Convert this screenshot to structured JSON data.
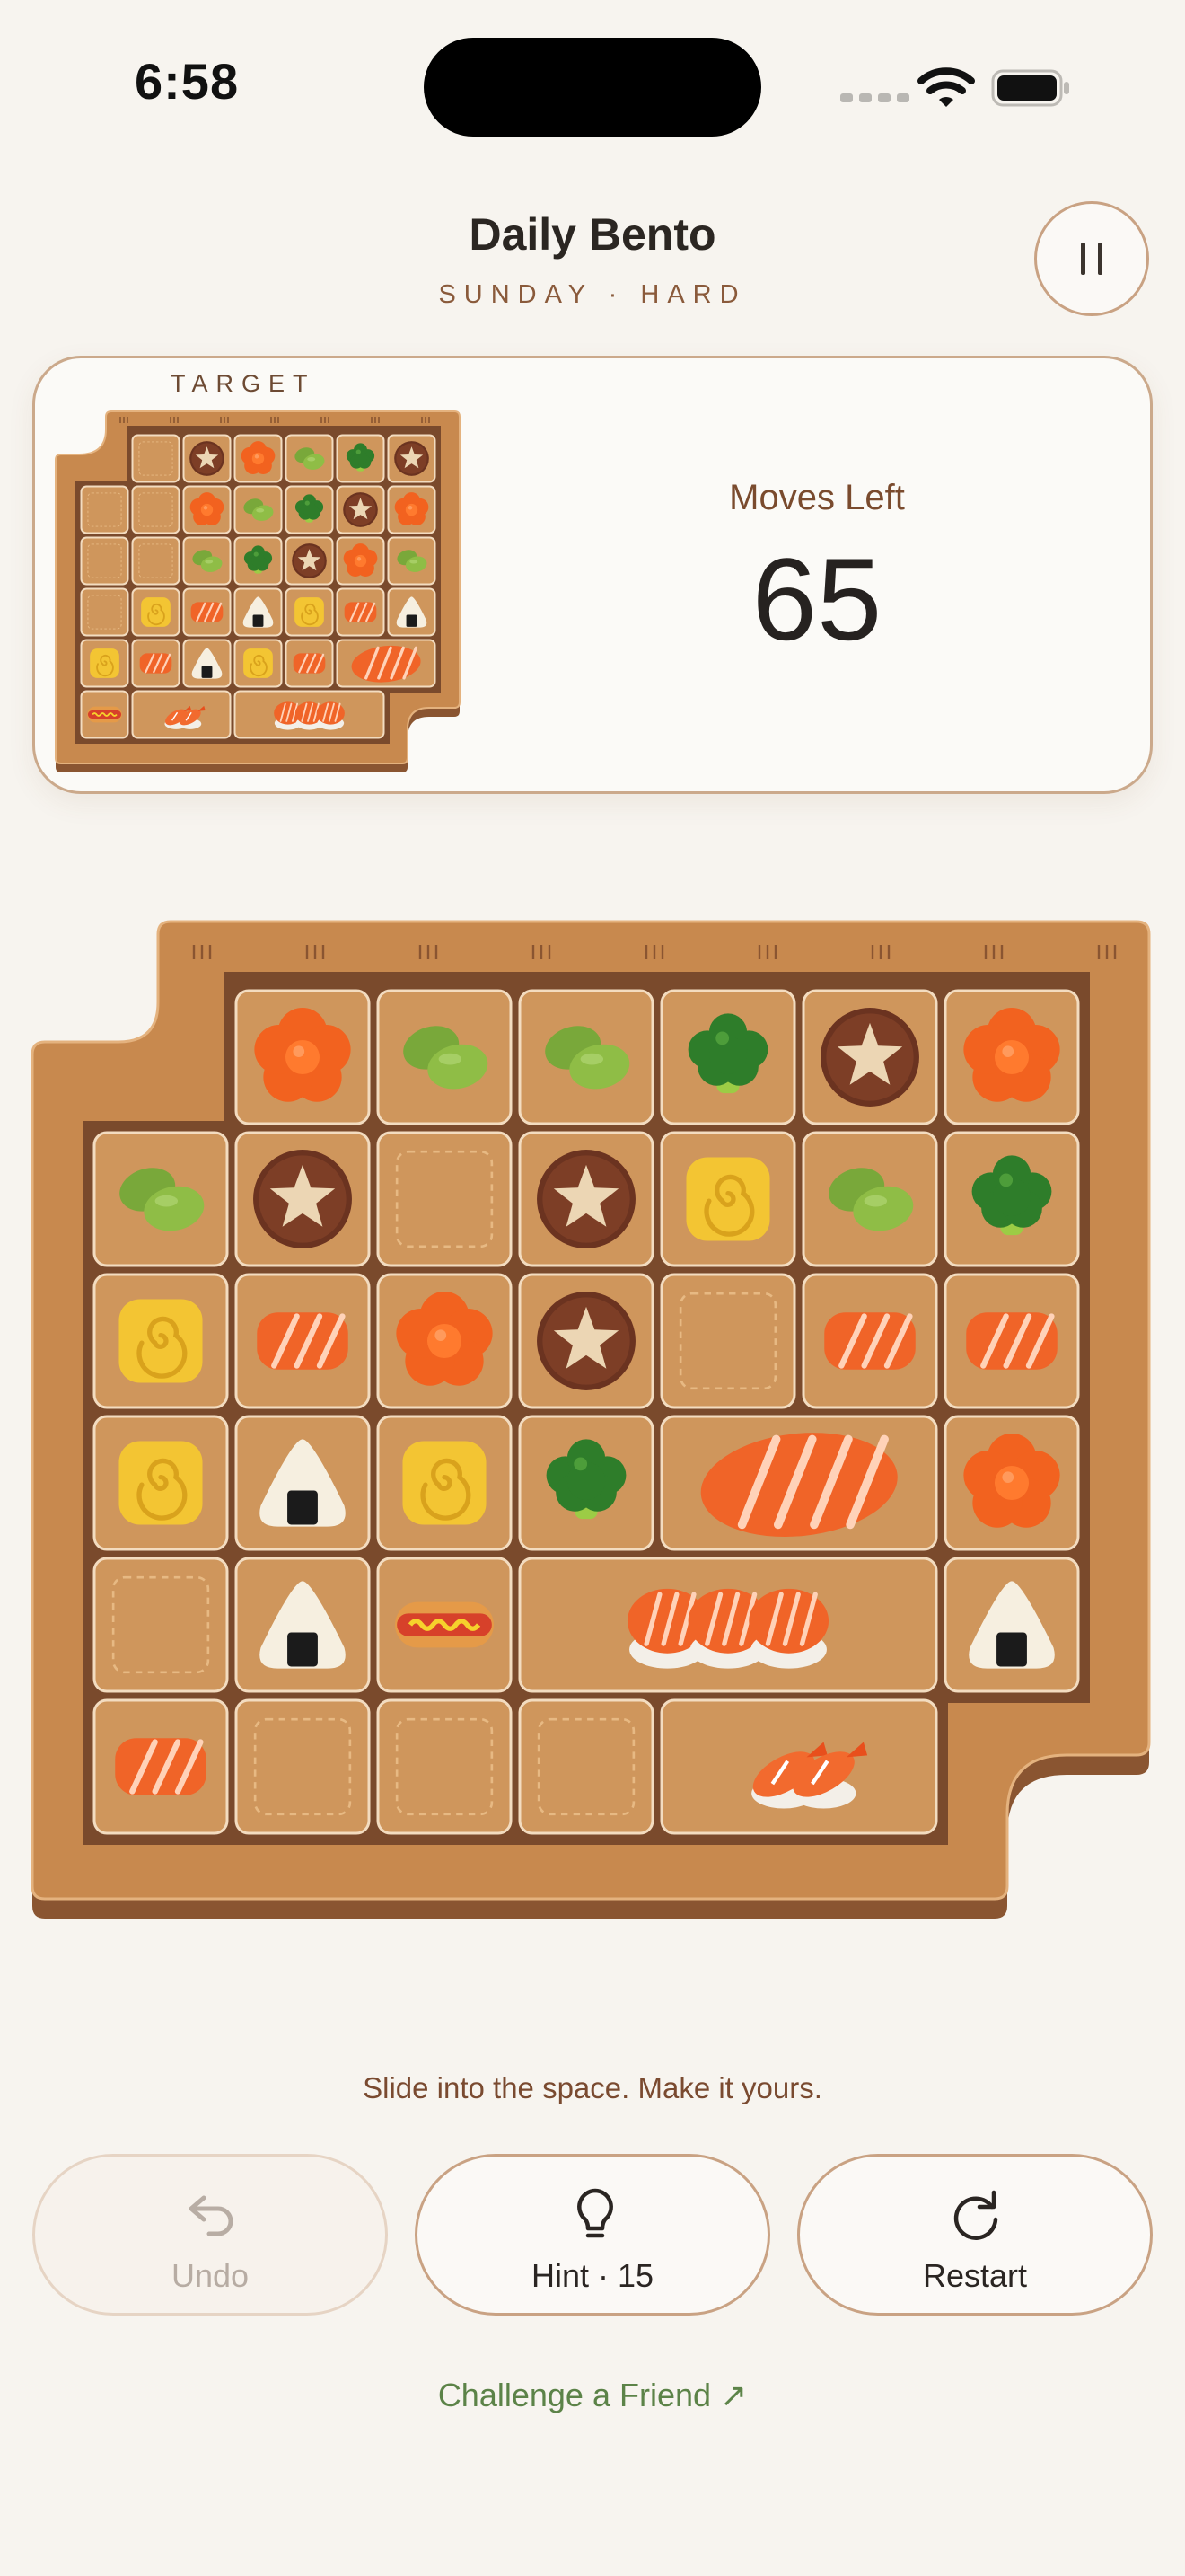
{
  "status_bar": {
    "time": "6:58"
  },
  "header": {
    "title": "Daily Bento",
    "subtitle": "SUNDAY · HARD"
  },
  "target_panel": {
    "label": "TARGET",
    "moves_label": "Moves Left",
    "moves_left": "65"
  },
  "board_layout": {
    "cols": 7,
    "rows": 6,
    "tiles": [
      {
        "r": 0,
        "c": 1,
        "w": 1,
        "h": 1,
        "item": "sakura"
      },
      {
        "r": 0,
        "c": 2,
        "w": 1,
        "h": 1,
        "item": "edamame"
      },
      {
        "r": 0,
        "c": 3,
        "w": 1,
        "h": 1,
        "item": "edamame"
      },
      {
        "r": 0,
        "c": 4,
        "w": 1,
        "h": 1,
        "item": "broccoli"
      },
      {
        "r": 0,
        "c": 5,
        "w": 1,
        "h": 1,
        "item": "shiitake"
      },
      {
        "r": 0,
        "c": 6,
        "w": 1,
        "h": 1,
        "item": "sakura"
      },
      {
        "r": 1,
        "c": 0,
        "w": 1,
        "h": 1,
        "item": "edamame"
      },
      {
        "r": 1,
        "c": 1,
        "w": 1,
        "h": 1,
        "item": "shiitake"
      },
      {
        "r": 1,
        "c": 2,
        "w": 1,
        "h": 1,
        "item": "empty"
      },
      {
        "r": 1,
        "c": 3,
        "w": 1,
        "h": 1,
        "item": "shiitake"
      },
      {
        "r": 1,
        "c": 4,
        "w": 1,
        "h": 1,
        "item": "tamago"
      },
      {
        "r": 1,
        "c": 5,
        "w": 1,
        "h": 1,
        "item": "edamame"
      },
      {
        "r": 1,
        "c": 6,
        "w": 1,
        "h": 1,
        "item": "broccoli"
      },
      {
        "r": 2,
        "c": 0,
        "w": 1,
        "h": 1,
        "item": "tamago"
      },
      {
        "r": 2,
        "c": 1,
        "w": 1,
        "h": 1,
        "item": "salmon"
      },
      {
        "r": 2,
        "c": 2,
        "w": 1,
        "h": 1,
        "item": "sakura"
      },
      {
        "r": 2,
        "c": 3,
        "w": 1,
        "h": 1,
        "item": "shiitake"
      },
      {
        "r": 2,
        "c": 4,
        "w": 1,
        "h": 1,
        "item": "empty"
      },
      {
        "r": 2,
        "c": 5,
        "w": 1,
        "h": 1,
        "item": "salmon"
      },
      {
        "r": 2,
        "c": 6,
        "w": 1,
        "h": 1,
        "item": "salmon"
      },
      {
        "r": 3,
        "c": 0,
        "w": 1,
        "h": 1,
        "item": "tamago"
      },
      {
        "r": 3,
        "c": 1,
        "w": 1,
        "h": 1,
        "item": "onigiri"
      },
      {
        "r": 3,
        "c": 2,
        "w": 1,
        "h": 1,
        "item": "tamago"
      },
      {
        "r": 3,
        "c": 3,
        "w": 1,
        "h": 1,
        "item": "broccoli"
      },
      {
        "r": 3,
        "c": 4,
        "w": 2,
        "h": 1,
        "item": "salmon-large"
      },
      {
        "r": 3,
        "c": 6,
        "w": 1,
        "h": 1,
        "item": "sakura"
      },
      {
        "r": 4,
        "c": 0,
        "w": 1,
        "h": 1,
        "item": "empty"
      },
      {
        "r": 4,
        "c": 1,
        "w": 1,
        "h": 1,
        "item": "onigiri"
      },
      {
        "r": 4,
        "c": 2,
        "w": 1,
        "h": 1,
        "item": "sausage"
      },
      {
        "r": 4,
        "c": 3,
        "w": 3,
        "h": 1,
        "item": "nigiri-trio"
      },
      {
        "r": 4,
        "c": 6,
        "w": 1,
        "h": 1,
        "item": "onigiri"
      },
      {
        "r": 5,
        "c": 0,
        "w": 1,
        "h": 1,
        "item": "salmon"
      },
      {
        "r": 5,
        "c": 1,
        "w": 1,
        "h": 1,
        "item": "empty"
      },
      {
        "r": 5,
        "c": 2,
        "w": 1,
        "h": 1,
        "item": "empty"
      },
      {
        "r": 5,
        "c": 3,
        "w": 1,
        "h": 1,
        "item": "empty"
      },
      {
        "r": 5,
        "c": 4,
        "w": 2,
        "h": 1,
        "item": "ebi-pair"
      }
    ]
  },
  "target_layout": {
    "cols": 7,
    "rows": 6,
    "tiles": [
      {
        "r": 0,
        "c": 1,
        "w": 1,
        "h": 1,
        "item": "empty"
      },
      {
        "r": 0,
        "c": 2,
        "w": 1,
        "h": 1,
        "item": "shiitake"
      },
      {
        "r": 0,
        "c": 3,
        "w": 1,
        "h": 1,
        "item": "sakura"
      },
      {
        "r": 0,
        "c": 4,
        "w": 1,
        "h": 1,
        "item": "edamame"
      },
      {
        "r": 0,
        "c": 5,
        "w": 1,
        "h": 1,
        "item": "broccoli"
      },
      {
        "r": 0,
        "c": 6,
        "w": 1,
        "h": 1,
        "item": "shiitake"
      },
      {
        "r": 1,
        "c": 0,
        "w": 1,
        "h": 1,
        "item": "empty"
      },
      {
        "r": 1,
        "c": 1,
        "w": 1,
        "h": 1,
        "item": "empty"
      },
      {
        "r": 1,
        "c": 2,
        "w": 1,
        "h": 1,
        "item": "sakura"
      },
      {
        "r": 1,
        "c": 3,
        "w": 1,
        "h": 1,
        "item": "edamame"
      },
      {
        "r": 1,
        "c": 4,
        "w": 1,
        "h": 1,
        "item": "broccoli"
      },
      {
        "r": 1,
        "c": 5,
        "w": 1,
        "h": 1,
        "item": "shiitake"
      },
      {
        "r": 1,
        "c": 6,
        "w": 1,
        "h": 1,
        "item": "sakura"
      },
      {
        "r": 2,
        "c": 0,
        "w": 1,
        "h": 1,
        "item": "empty"
      },
      {
        "r": 2,
        "c": 1,
        "w": 1,
        "h": 1,
        "item": "empty"
      },
      {
        "r": 2,
        "c": 2,
        "w": 1,
        "h": 1,
        "item": "edamame"
      },
      {
        "r": 2,
        "c": 3,
        "w": 1,
        "h": 1,
        "item": "broccoli"
      },
      {
        "r": 2,
        "c": 4,
        "w": 1,
        "h": 1,
        "item": "shiitake"
      },
      {
        "r": 2,
        "c": 5,
        "w": 1,
        "h": 1,
        "item": "sakura"
      },
      {
        "r": 2,
        "c": 6,
        "w": 1,
        "h": 1,
        "item": "edamame"
      },
      {
        "r": 3,
        "c": 0,
        "w": 1,
        "h": 1,
        "item": "empty"
      },
      {
        "r": 3,
        "c": 1,
        "w": 1,
        "h": 1,
        "item": "tamago"
      },
      {
        "r": 3,
        "c": 2,
        "w": 1,
        "h": 1,
        "item": "salmon"
      },
      {
        "r": 3,
        "c": 3,
        "w": 1,
        "h": 1,
        "item": "onigiri"
      },
      {
        "r": 3,
        "c": 4,
        "w": 1,
        "h": 1,
        "item": "tamago"
      },
      {
        "r": 3,
        "c": 5,
        "w": 1,
        "h": 1,
        "item": "salmon"
      },
      {
        "r": 3,
        "c": 6,
        "w": 1,
        "h": 1,
        "item": "onigiri"
      },
      {
        "r": 4,
        "c": 0,
        "w": 1,
        "h": 1,
        "item": "tamago"
      },
      {
        "r": 4,
        "c": 1,
        "w": 1,
        "h": 1,
        "item": "salmon"
      },
      {
        "r": 4,
        "c": 2,
        "w": 1,
        "h": 1,
        "item": "onigiri"
      },
      {
        "r": 4,
        "c": 3,
        "w": 1,
        "h": 1,
        "item": "tamago"
      },
      {
        "r": 4,
        "c": 4,
        "w": 1,
        "h": 1,
        "item": "salmon"
      },
      {
        "r": 4,
        "c": 5,
        "w": 2,
        "h": 1,
        "item": "salmon-large"
      },
      {
        "r": 5,
        "c": 0,
        "w": 1,
        "h": 1,
        "item": "sausage"
      },
      {
        "r": 5,
        "c": 1,
        "w": 2,
        "h": 1,
        "item": "ebi-pair"
      },
      {
        "r": 5,
        "c": 3,
        "w": 3,
        "h": 1,
        "item": "nigiri-trio"
      }
    ]
  },
  "footer": {
    "tagline": "Slide into the space. Make it yours.",
    "undo_label": "Undo",
    "hint_label": "Hint · 15",
    "restart_label": "Restart",
    "challenge_label": "Challenge a Friend ↗"
  },
  "colors": {
    "background": "#f7f4ef",
    "board_wood": "#c8894e",
    "board_inner": "#7a4a2c",
    "tile": "#cf965c",
    "tile_border": "#f3dcc0",
    "accent_brown": "#8a5a3b",
    "accent_green": "#5c8348"
  },
  "icons": {
    "undo": "undo-arrow-icon",
    "hint": "lightbulb-icon",
    "restart": "restart-arrow-icon",
    "pause": "pause-icon"
  }
}
